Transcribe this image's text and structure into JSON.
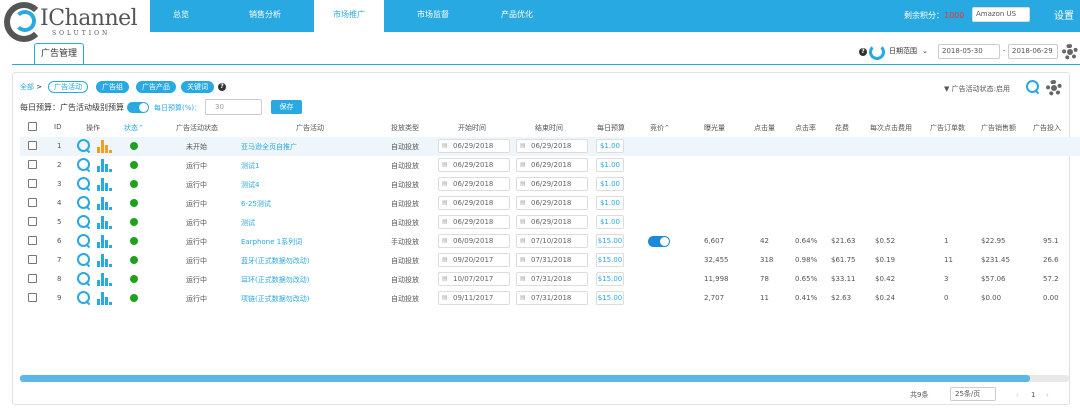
{
  "header": {
    "logo_text": "IChannel",
    "logo_sub": "SOLUTION",
    "nav": [
      "总览",
      "销售分析",
      "市场推广",
      "市场监督",
      "产品优化"
    ],
    "active_nav": 2,
    "credit_label": "剩余积分：",
    "credit_value": "1000",
    "store": "Amazon US",
    "settings": "设置"
  },
  "subtab": {
    "label": "广告管理"
  },
  "date_filter": {
    "label": "日期范围",
    "start": "2018-05-30",
    "end": "2018-06-29",
    "sep": "-"
  },
  "filters": {
    "crumb_all": "全部",
    "crumb_sep": ">",
    "pills": [
      "广告活动",
      "广告组",
      "广告产品",
      "关键词"
    ],
    "budget_label": "每日预算：",
    "budget_by_campaign": "广告活动级别预算",
    "daily_budget_toggle": "每日预算(%)：",
    "budget_placeholder": "30",
    "save": "保存",
    "status_filter": "广告活动状态:启用"
  },
  "table": {
    "headers": [
      "ID",
      "操作",
      "状态",
      "广告活动状态",
      "广告活动",
      "投放类型",
      "开始时间",
      "结束时间",
      "每日预算",
      "竞价",
      "曝光量",
      "点击量",
      "点击率",
      "花费",
      "每次点击费用",
      "广告订单数",
      "广告销售额",
      "广告投入"
    ],
    "status_sort": "状态",
    "bid_sort": "竞价",
    "rows": [
      {
        "id": "1",
        "state": "未开始",
        "name": "亚马逊全页自推广",
        "type": "自动投放",
        "start": "06/29/2018",
        "end": "06/29/2018",
        "budget": "$1.00",
        "bid": false,
        "imp": "",
        "clk": "",
        "ctr": "",
        "spend": "",
        "cpc": "",
        "orders": "",
        "sales": "",
        "acos": ""
      },
      {
        "id": "2",
        "state": "运行中",
        "name": "测试1",
        "type": "自动投放",
        "start": "06/29/2018",
        "end": "06/29/2018",
        "budget": "$1.00",
        "bid": false,
        "imp": "",
        "clk": "",
        "ctr": "",
        "spend": "",
        "cpc": "",
        "orders": "",
        "sales": "",
        "acos": ""
      },
      {
        "id": "3",
        "state": "运行中",
        "name": "测试4",
        "type": "自动投放",
        "start": "06/29/2018",
        "end": "06/29/2018",
        "budget": "$1.00",
        "bid": false,
        "imp": "",
        "clk": "",
        "ctr": "",
        "spend": "",
        "cpc": "",
        "orders": "",
        "sales": "",
        "acos": ""
      },
      {
        "id": "4",
        "state": "运行中",
        "name": "6-25测试",
        "type": "自动投放",
        "start": "06/29/2018",
        "end": "06/29/2018",
        "budget": "$1.00",
        "bid": false,
        "imp": "",
        "clk": "",
        "ctr": "",
        "spend": "",
        "cpc": "",
        "orders": "",
        "sales": "",
        "acos": ""
      },
      {
        "id": "5",
        "state": "运行中",
        "name": "测试",
        "type": "自动投放",
        "start": "06/29/2018",
        "end": "06/29/2018",
        "budget": "$1.00",
        "bid": false,
        "imp": "",
        "clk": "",
        "ctr": "",
        "spend": "",
        "cpc": "",
        "orders": "",
        "sales": "",
        "acos": ""
      },
      {
        "id": "6",
        "state": "运行中",
        "name": "Earphone 1系列词",
        "type": "手动投放",
        "start": "06/09/2018",
        "end": "07/10/2018",
        "budget": "$15.00",
        "bid": true,
        "imp": "6,607",
        "clk": "42",
        "ctr": "0.64%",
        "spend": "$21.63",
        "cpc": "$0.52",
        "orders": "1",
        "sales": "$22.95",
        "acos": "95.1"
      },
      {
        "id": "7",
        "state": "运行中",
        "name": "蓝牙(正式数据勿改动)",
        "type": "自动投放",
        "start": "09/20/2017",
        "end": "07/31/2018",
        "budget": "$15.00",
        "bid": false,
        "imp": "32,455",
        "clk": "318",
        "ctr": "0.98%",
        "spend": "$61.75",
        "cpc": "$0.19",
        "orders": "11",
        "sales": "$231.45",
        "acos": "26.6"
      },
      {
        "id": "8",
        "state": "运行中",
        "name": "耳环(正式数据勿改动)",
        "type": "自动投放",
        "start": "10/07/2017",
        "end": "07/31/2018",
        "budget": "$15.00",
        "bid": false,
        "imp": "11,998",
        "clk": "78",
        "ctr": "0.65%",
        "spend": "$33.11",
        "cpc": "$0.42",
        "orders": "3",
        "sales": "$57.06",
        "acos": "57.2"
      },
      {
        "id": "9",
        "state": "运行中",
        "name": "项链(正式数据勿改动)",
        "type": "自动投放",
        "start": "09/11/2017",
        "end": "07/31/2018",
        "budget": "$15.00",
        "bid": false,
        "imp": "2,707",
        "clk": "11",
        "ctr": "0.41%",
        "spend": "$2.63",
        "cpc": "$0.24",
        "orders": "0",
        "sales": "$0.00",
        "acos": "0.00"
      }
    ]
  },
  "pagination": {
    "total": "共9条",
    "per_page": "25条/页",
    "page": "1",
    "prev": "‹",
    "next": "›"
  },
  "colors": {
    "accent": "#29a9e1",
    "active_status": "#1fa11f",
    "chart_orange": "#f0a020"
  }
}
